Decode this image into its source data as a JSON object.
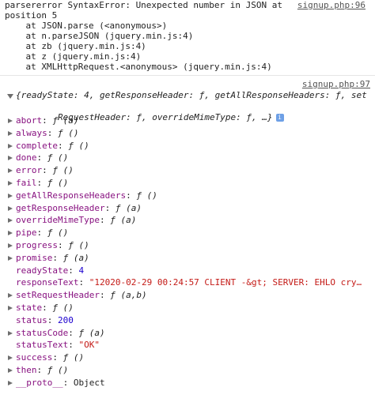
{
  "error_block": {
    "lines": [
      "parsererror SyntaxError: Unexpected number in JSON at",
      "position 5",
      "    at JSON.parse (<anonymous>)",
      "    at n.parseJSON (jquery.min.js:4)",
      "    at zb (jquery.min.js:4)",
      "    at z (jquery.min.js:4)",
      "    at XMLHttpRequest.<anonymous> (jquery.min.js:4)"
    ],
    "source": "signup.php:96"
  },
  "object_log": {
    "source": "signup.php:97",
    "summary_line1": "{readyState: 4, getResponseHeader: ƒ, getAllResponseHeaders: ƒ, set",
    "summary_line2": "RequestHeader: ƒ, overrideMimeType: ƒ, …}",
    "info_badge": "i",
    "properties": [
      {
        "key": "abort",
        "value": "ƒ (a)",
        "type": "function",
        "expandable": true
      },
      {
        "key": "always",
        "value": "ƒ ()",
        "type": "function",
        "expandable": true
      },
      {
        "key": "complete",
        "value": "ƒ ()",
        "type": "function",
        "expandable": true
      },
      {
        "key": "done",
        "value": "ƒ ()",
        "type": "function",
        "expandable": true
      },
      {
        "key": "error",
        "value": "ƒ ()",
        "type": "function",
        "expandable": true
      },
      {
        "key": "fail",
        "value": "ƒ ()",
        "type": "function",
        "expandable": true
      },
      {
        "key": "getAllResponseHeaders",
        "value": "ƒ ()",
        "type": "function",
        "expandable": true
      },
      {
        "key": "getResponseHeader",
        "value": "ƒ (a)",
        "type": "function",
        "expandable": true
      },
      {
        "key": "overrideMimeType",
        "value": "ƒ (a)",
        "type": "function",
        "expandable": true
      },
      {
        "key": "pipe",
        "value": "ƒ ()",
        "type": "function",
        "expandable": true
      },
      {
        "key": "progress",
        "value": "ƒ ()",
        "type": "function",
        "expandable": true
      },
      {
        "key": "promise",
        "value": "ƒ (a)",
        "type": "function",
        "expandable": true
      },
      {
        "key": "readyState",
        "value": "4",
        "type": "number",
        "expandable": false
      },
      {
        "key": "responseText",
        "value": "\"12020-02-29 00:24:57 CLIENT -&gt; SERVER: EHLO cry…",
        "type": "string",
        "expandable": false
      },
      {
        "key": "setRequestHeader",
        "value": "ƒ (a,b)",
        "type": "function",
        "expandable": true
      },
      {
        "key": "state",
        "value": "ƒ ()",
        "type": "function",
        "expandable": true
      },
      {
        "key": "status",
        "value": "200",
        "type": "number",
        "expandable": false
      },
      {
        "key": "statusCode",
        "value": "ƒ (a)",
        "type": "function",
        "expandable": true
      },
      {
        "key": "statusText",
        "value": "\"OK\"",
        "type": "string",
        "expandable": false
      },
      {
        "key": "success",
        "value": "ƒ ()",
        "type": "function",
        "expandable": true
      },
      {
        "key": "then",
        "value": "ƒ ()",
        "type": "function",
        "expandable": true
      },
      {
        "key": "__proto__",
        "value": "Object",
        "type": "plain",
        "expandable": true
      }
    ]
  },
  "colors": {
    "key": "#881280",
    "number": "#1c00cf",
    "string": "#c41a16",
    "link": "#545454",
    "arrow": "#6e6e6e"
  }
}
